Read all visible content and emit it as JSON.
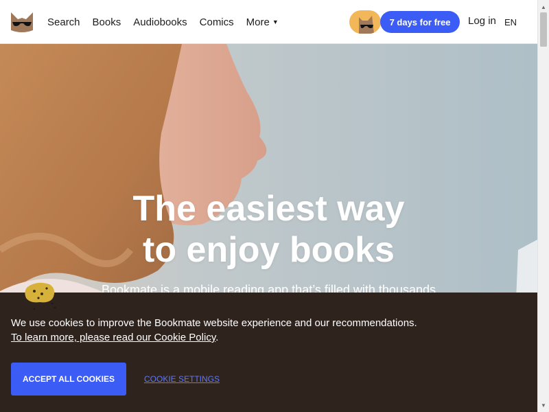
{
  "header": {
    "logo_icon": "bookmate-cat-logo-icon",
    "nav": [
      {
        "label": "Search"
      },
      {
        "label": "Books"
      },
      {
        "label": "Audiobooks"
      },
      {
        "label": "Comics"
      },
      {
        "label": "More"
      }
    ],
    "more_icon": "caret-down-icon",
    "mascot_icon": "cat-mascot-icon",
    "trial_button": "7 days for free",
    "login": "Log in",
    "language": "EN"
  },
  "hero": {
    "title_line1": "The easiest way",
    "title_line2": "to enjoy books",
    "subtitle": "Bookmate is a mobile reading app that’s filled with thousands"
  },
  "cookie_banner": {
    "mascot_icon": "cookie-mascot-icon",
    "message": "We use cookies to improve the Bookmate website experience and our recommendations.",
    "policy_link": "To learn more, please read our Cookie Policy",
    "policy_suffix": ".",
    "accept_button": "ACCEPT ALL COOKIES",
    "settings_link": "COOKIE SETTINGS"
  },
  "colors": {
    "accent_blue": "#3c5cf6",
    "banner_bg": "#2f231e",
    "mascot_yellow": "#f2b758",
    "settings_link": "#5b78ff"
  }
}
